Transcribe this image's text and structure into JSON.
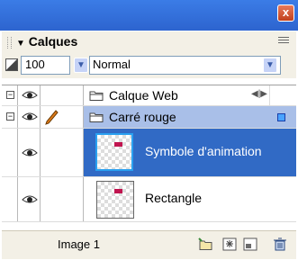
{
  "window": {
    "close_label": "x"
  },
  "panel": {
    "title": "Calques"
  },
  "toolbar": {
    "opacity_value": "100",
    "blend_mode": "Normal"
  },
  "layers": [
    {
      "name": "Calque Web",
      "type": "folder",
      "expanded": true
    },
    {
      "name": "Carré rouge",
      "type": "folder",
      "expanded": true,
      "selected": true
    },
    {
      "name": "Symbole d'animation",
      "type": "object",
      "selected": true
    },
    {
      "name": "Rectangle",
      "type": "object",
      "selected": false
    }
  ],
  "status": {
    "frame_label": "Image 1"
  },
  "icons": {
    "eye": "eye-icon",
    "pencil": "pencil-icon",
    "folder": "folder-icon",
    "new_layer": "new-layer-icon",
    "new_symbol": "new-symbol-icon",
    "new_sublayer": "new-sublayer-icon",
    "trash": "trash-icon"
  },
  "colors": {
    "titlebar": "#2d64cf",
    "selection": "#316ac5",
    "layer_selected": "#a9bfe8",
    "accent_mark": "#c0144f"
  }
}
